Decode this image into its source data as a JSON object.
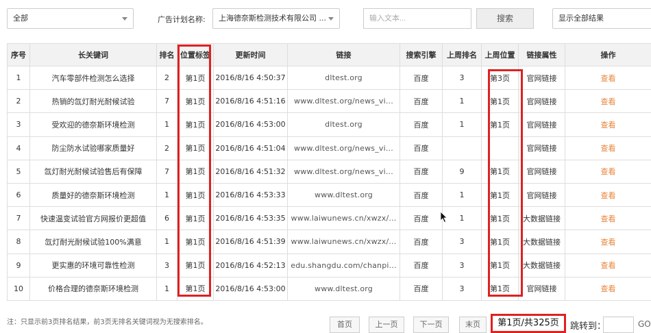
{
  "filters": {
    "category": "全部",
    "plan_label": "广告计划名称:",
    "plan_value": "上海德奈斯检测技术有限公司 ...",
    "text_placeholder": "输入文本...",
    "search_label": "搜索",
    "display_value": "显示全部结果"
  },
  "table": {
    "headers": [
      "序号",
      "长关键词",
      "排名",
      "位置标签",
      "更新时间",
      "链接",
      "搜索引擎",
      "上周排名",
      "上周位置",
      "链接属性",
      "操作"
    ],
    "rows": [
      {
        "idx": "1",
        "keyword": "汽车零部件检测怎么选择",
        "rank": "2",
        "tag": "第1页",
        "time": "2016/8/16 4:50:37",
        "url": "dltest.org",
        "engine": "百度",
        "last_rank": "3",
        "last_pos": "第3页",
        "attr": "官网链接",
        "action": "查看"
      },
      {
        "idx": "2",
        "keyword": "热销的氙灯耐光耐候试验",
        "rank": "7",
        "tag": "第1页",
        "time": "2016/8/16 4:51:16",
        "url": "www.dltest.org/news_vi...",
        "engine": "百度",
        "last_rank": "1",
        "last_pos": "第1页",
        "attr": "官网链接",
        "action": "查看"
      },
      {
        "idx": "3",
        "keyword": "受欢迎的德奈斯环境检测",
        "rank": "1",
        "tag": "第1页",
        "time": "2016/8/16 4:53:00",
        "url": "dltest.org",
        "engine": "百度",
        "last_rank": "1",
        "last_pos": "第1页",
        "attr": "官网链接",
        "action": "查看"
      },
      {
        "idx": "4",
        "keyword": "防尘防水试验哪家质量好",
        "rank": "2",
        "tag": "第1页",
        "time": "2016/8/16 4:51:04",
        "url": "www.dltest.org/news_vi...",
        "engine": "百度",
        "last_rank": "",
        "last_pos": "",
        "attr": "官网链接",
        "action": "查看"
      },
      {
        "idx": "5",
        "keyword": "氙灯耐光耐候试验售后有保障",
        "rank": "7",
        "tag": "第1页",
        "time": "2016/8/16 4:51:32",
        "url": "www.dltest.org/news_vi...",
        "engine": "百度",
        "last_rank": "9",
        "last_pos": "第1页",
        "attr": "官网链接",
        "action": "查看"
      },
      {
        "idx": "6",
        "keyword": "质量好的德奈斯环境检测",
        "rank": "1",
        "tag": "第1页",
        "time": "2016/8/16 4:53:33",
        "url": "www.dltest.org",
        "engine": "百度",
        "last_rank": "1",
        "last_pos": "第1页",
        "attr": "官网链接",
        "action": "查看"
      },
      {
        "idx": "7",
        "keyword": "快速温变试验官方网报价更超值",
        "rank": "6",
        "tag": "第1页",
        "time": "2016/8/16 4:53:35",
        "url": "www.laiwunews.cn/xwzx/...",
        "engine": "百度",
        "last_rank": "1",
        "last_pos": "第1页",
        "attr": "大数据链接",
        "action": "查看"
      },
      {
        "idx": "8",
        "keyword": "氙灯耐光耐候试验100%满意",
        "rank": "1",
        "tag": "第1页",
        "time": "2016/8/16 4:51:39",
        "url": "www.laiwunews.cn/xwzx/...",
        "engine": "百度",
        "last_rank": "3",
        "last_pos": "第1页",
        "attr": "大数据链接",
        "action": "查看"
      },
      {
        "idx": "9",
        "keyword": "更实惠的环境可靠性检测",
        "rank": "3",
        "tag": "第1页",
        "time": "2016/8/16 4:52:13",
        "url": "edu.shangdu.com/chanpi...",
        "engine": "百度",
        "last_rank": "3",
        "last_pos": "第1页",
        "attr": "大数据链接",
        "action": "查看"
      },
      {
        "idx": "10",
        "keyword": "价格合理的德奈斯环境检测",
        "rank": "1",
        "tag": "第1页",
        "time": "2016/8/16 4:53:00",
        "url": "www.dltest.org",
        "engine": "百度",
        "last_rank": "3",
        "last_pos": "第1页",
        "attr": "官网链接",
        "action": "查看"
      }
    ]
  },
  "footer": {
    "note": "注：只显示前3页排名结果，前3页无排名关键词视为无搜索排名。",
    "first": "首页",
    "prev": "上一页",
    "next": "下一页",
    "last": "末页",
    "page_info": "第1页/共325页",
    "jump_label": "跳转到：",
    "go": "GO"
  },
  "colors": {
    "highlight": "#e02020",
    "action_link": "#e8853a"
  }
}
